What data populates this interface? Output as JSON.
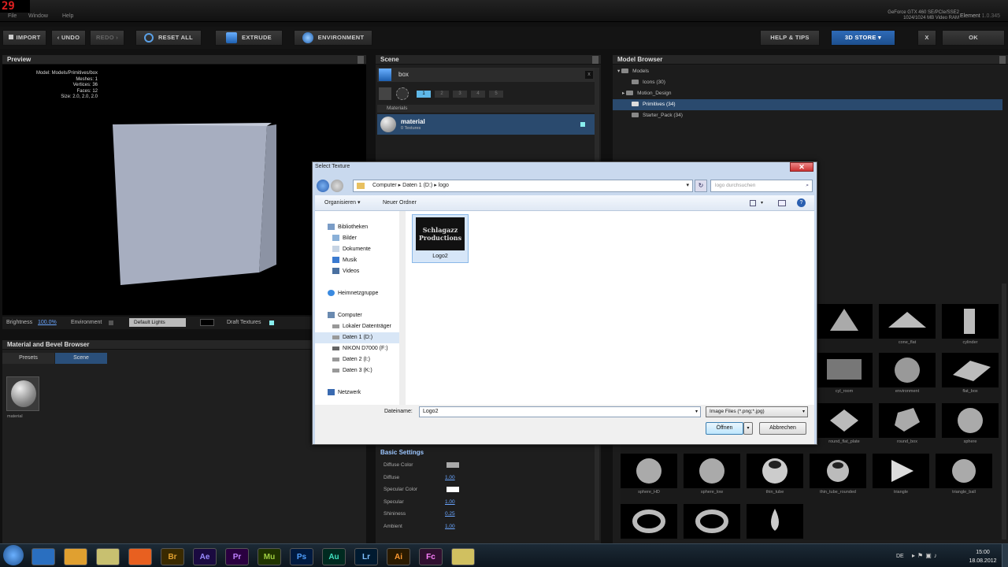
{
  "app": {
    "fps": "29",
    "menu": [
      "File",
      "Window",
      "Help"
    ],
    "gpu_line1": "GeForce GTX 460 SE/PCIe/SSE2",
    "gpu_line2": "1024/1024 MB Video RAM",
    "element_label": "Element",
    "element_version": "1.0.345"
  },
  "toolbar": {
    "import": "IMPORT",
    "undo": "UNDO",
    "redo": "REDO",
    "reset_all": "RESET ALL",
    "extrude": "EXTRUDE",
    "environment": "ENVIRONMENT",
    "help": "HELP & TIPS",
    "store": "3D STORE",
    "close": "X",
    "ok": "OK"
  },
  "preview": {
    "title": "Preview",
    "stats": [
      "Model: Models/Primitives/box",
      "Meshes: 1",
      "Vertices: 36",
      "Faces: 12",
      "Size: 2.0, 2.0, 2.0"
    ],
    "brightness_label": "Brightness",
    "brightness_value": "100.0%",
    "environment_label": "Environment",
    "lights_value": "Default Lights",
    "draft_label": "Draft Textures"
  },
  "material_browser": {
    "title": "Material and Bevel Browser",
    "tabs": [
      "Presets",
      "Scene"
    ],
    "item_label": "material"
  },
  "scene": {
    "title": "Scene",
    "object_name": "box",
    "group_numbers": [
      "1",
      "2",
      "3",
      "4",
      "5"
    ],
    "materials_label": "Materials",
    "material_name": "material",
    "material_sub": "0 Textures",
    "basic_settings": "Basic Settings",
    "settings": [
      {
        "label": "Diffuse Color",
        "value": ""
      },
      {
        "label": "Diffuse",
        "value": "1.00"
      },
      {
        "label": "Specular Color",
        "value": ""
      },
      {
        "label": "Specular",
        "value": "1.00"
      },
      {
        "label": "Shininess",
        "value": "0.25"
      },
      {
        "label": "Ambient",
        "value": "1.00"
      }
    ]
  },
  "model_browser": {
    "title": "Model Browser",
    "tree": [
      {
        "label": "Models",
        "indent": 0
      },
      {
        "label": "Icons (30)",
        "indent": 1
      },
      {
        "label": "Motion_Design",
        "indent": 1
      },
      {
        "label": "Primitives (34)",
        "indent": 1,
        "selected": true
      },
      {
        "label": "Starter_Pack (34)",
        "indent": 1
      }
    ],
    "thumbs_row1": [
      "",
      "cone_flat",
      "cylinder"
    ],
    "thumbs_row2": [
      "cyl_room",
      "environment",
      "flat_box"
    ],
    "thumbs_row3": [
      "round_flat_plate",
      "round_box",
      "sphere"
    ],
    "thumbs_row4": [
      "sphere_HD",
      "sphere_low",
      "thin_tube",
      "thin_tube_rounded",
      "triangle",
      "triangle_ball"
    ],
    "thumbs_row5": [
      "tube_bevel",
      "tube_rounded",
      "water_drop"
    ]
  },
  "dialog": {
    "title": "Select Texture",
    "close": "✕",
    "breadcrumb": [
      "Computer",
      "Daten 1 (D:)",
      "logo"
    ],
    "search_placeholder": "logo durchsuchen",
    "organize": "Organisieren ▾",
    "new_folder": "Neuer Ordner",
    "nav": [
      {
        "label": "Bibliotheken",
        "level": 0
      },
      {
        "label": "Bilder",
        "level": 1
      },
      {
        "label": "Dokumente",
        "level": 1
      },
      {
        "label": "Musik",
        "level": 1
      },
      {
        "label": "Videos",
        "level": 1
      },
      {
        "label": "",
        "level": 0
      },
      {
        "label": "Heimnetzgruppe",
        "level": 0
      },
      {
        "label": "",
        "level": 0
      },
      {
        "label": "Computer",
        "level": 0
      },
      {
        "label": "Lokaler Datenträger",
        "level": 1
      },
      {
        "label": "Daten 1 (D:)",
        "level": 1,
        "selected": true
      },
      {
        "label": "NIKON D7000 (F:)",
        "level": 1
      },
      {
        "label": "Daten 2 (I:)",
        "level": 1
      },
      {
        "label": "Daten 3 (K:)",
        "level": 1
      },
      {
        "label": "",
        "level": 0
      },
      {
        "label": "Netzwerk",
        "level": 0
      }
    ],
    "file_name": "Logo2",
    "logo_text_1": "Schlagazz",
    "logo_text_2": "Productions",
    "filename_label": "Dateiname:",
    "filename_value": "Logo2",
    "filetype": "Image Files (*.png;*.jpg)",
    "open": "Öffnen",
    "cancel": "Abbrechen"
  },
  "taskbar": {
    "apps": [
      "",
      "",
      "",
      "",
      "Br",
      "Ae",
      "Pr",
      "Mu",
      "Ps",
      "Au",
      "Lr",
      "Ai",
      "Fc",
      ""
    ],
    "lang": "DE",
    "time": "15:00",
    "date": "18.08.2012"
  }
}
